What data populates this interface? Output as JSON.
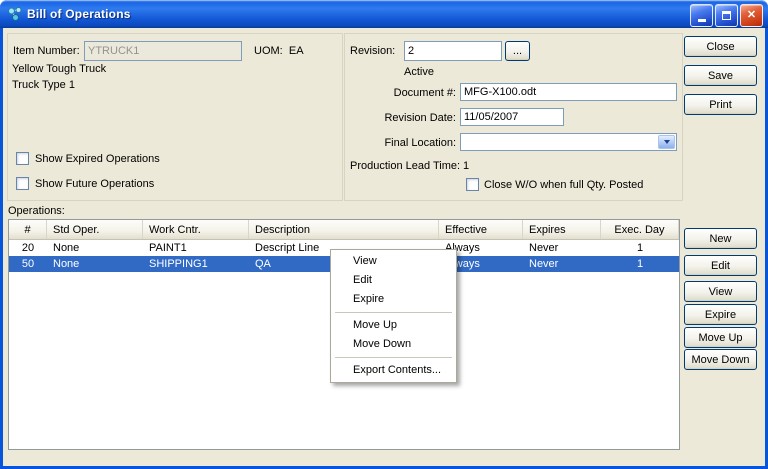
{
  "window": {
    "title": "Bill of Operations"
  },
  "item_section": {
    "item_number_label": "Item Number:",
    "item_number_value": "YTRUCK1",
    "uom_label": "UOM:",
    "uom_value": "EA",
    "item_desc_line1": "Yellow Tough Truck",
    "item_desc_line2": "Truck Type 1",
    "show_expired_label": "Show Expired Operations",
    "show_future_label": "Show Future Operations"
  },
  "revision_section": {
    "revision_label": "Revision:",
    "revision_value": "2",
    "browse_button_label": "...",
    "status_text": "Active",
    "document_label": "Document #:",
    "document_value": "MFG-X100.odt",
    "revision_date_label": "Revision Date:",
    "revision_date_value": "11/05/2007",
    "final_location_label": "Final Location:",
    "final_location_value": "",
    "lead_time_label": "Production Lead Time:",
    "lead_time_value": "1",
    "close_wo_label": "Close W/O when full Qty. Posted"
  },
  "dialog_buttons": {
    "close": "Close",
    "save": "Save",
    "print": "Print"
  },
  "operations": {
    "section_label": "Operations:",
    "columns": [
      "#",
      "Std Oper.",
      "Work Cntr.",
      "Description",
      "Effective",
      "Expires",
      "Exec. Day"
    ],
    "rows": [
      [
        "20",
        "None",
        "PAINT1",
        "Descript Line",
        "Always",
        "Never",
        "1"
      ],
      [
        "50",
        "None",
        "SHIPPING1",
        "QA",
        "Always",
        "Never",
        "1"
      ]
    ],
    "selected_row_index": 1,
    "buttons": {
      "new": "New",
      "edit": "Edit",
      "view": "View",
      "expire": "Expire",
      "move_up": "Move Up",
      "move_down": "Move Down"
    }
  },
  "context_menu": {
    "view": "View",
    "edit": "Edit",
    "expire": "Expire",
    "move_up": "Move Up",
    "move_down": "Move Down",
    "export": "Export Contents..."
  },
  "colors": {
    "titlebar_blue": "#1256D4",
    "selection_blue": "#316AC5",
    "content_bg": "#ECE9D8",
    "close_button_red": "#C93A12"
  }
}
